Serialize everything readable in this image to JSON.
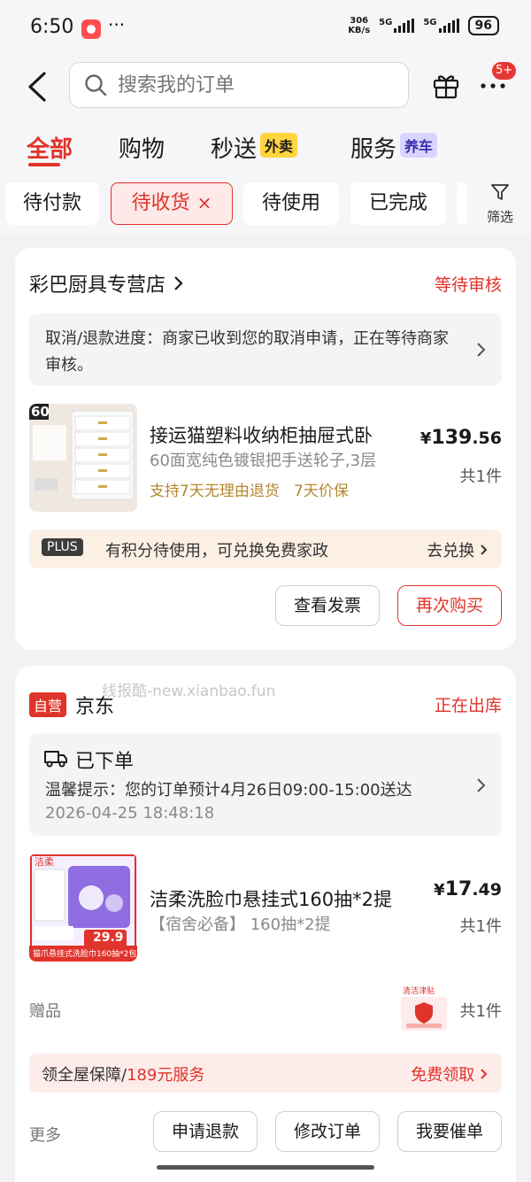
{
  "status_bar": {
    "time": "6:50",
    "dots": "···",
    "net_speed_value": "306",
    "net_speed_unit": "KB/s",
    "sim1": "5G",
    "sim2": "5G",
    "battery": "96"
  },
  "header": {
    "search_placeholder": "搜索我的订单",
    "more_badge": "5+"
  },
  "tabs": [
    {
      "label": "全部",
      "active": true
    },
    {
      "label": "购物"
    },
    {
      "label": "秒送",
      "tag": "外卖"
    },
    {
      "label": "服务",
      "tag": "养车"
    }
  ],
  "filters": {
    "chips": [
      "待付款",
      "待收货",
      "待使用",
      "已完成"
    ],
    "active_close": "×",
    "filter_label": "筛选"
  },
  "order1": {
    "shop": "彩巴厨具专营店",
    "status": "等待审核",
    "notice": "取消/退款进度：商家已收到您的取消申请，正在等待商家审核。",
    "product": {
      "title": "接运猫塑料收纳柜抽屉式卧",
      "subtitle": "60面宽纯色镀银把手送轮子,3层",
      "tags": "支持7天无理由退货   7天价保",
      "currency": "¥",
      "price_int": "139",
      "price_dec": ".56",
      "qty": "共1件",
      "img_badge": "60"
    },
    "plus": {
      "badge": "PLUS",
      "text": "有积分待使用，可兑换免费家政",
      "link": "去兑换"
    },
    "buttons": {
      "invoice": "查看发票",
      "rebuy": "再次购买"
    }
  },
  "order2": {
    "self_badge": "自营",
    "shop": "京东",
    "watermark": "线报酷-new.xianbao.fun",
    "status": "正在出库",
    "logistics": {
      "title": "已下单",
      "tip": "温馨提示：您的订单预计4月26日09:00-15:00送达",
      "date": "2026-04-25 18:48:18"
    },
    "product": {
      "title": "洁柔洗脸巾悬挂式160抽*2提",
      "subtitle": "【宿舍必备】 160抽*2提",
      "currency": "¥",
      "price_int": "17",
      "price_dec": ".49",
      "qty": "共1件",
      "img_brand": "洁柔",
      "img_price": "29.9",
      "img_caption": "猫爪悬挂式洗脸巾160抽*2包"
    },
    "gift": {
      "label": "赠品",
      "img_label": "清洁津贴",
      "qty": "共1件"
    },
    "guarantee": {
      "prefix": "领全屋保障/",
      "accent": "189元服务",
      "link": "免费领取"
    },
    "more": "更多",
    "buttons": {
      "refund": "申请退款",
      "modify": "修改订单",
      "urge": "我要催单"
    }
  },
  "colors": {
    "accent": "#e0332b",
    "background": "#f2f2f4",
    "gold": "#b4862e"
  }
}
